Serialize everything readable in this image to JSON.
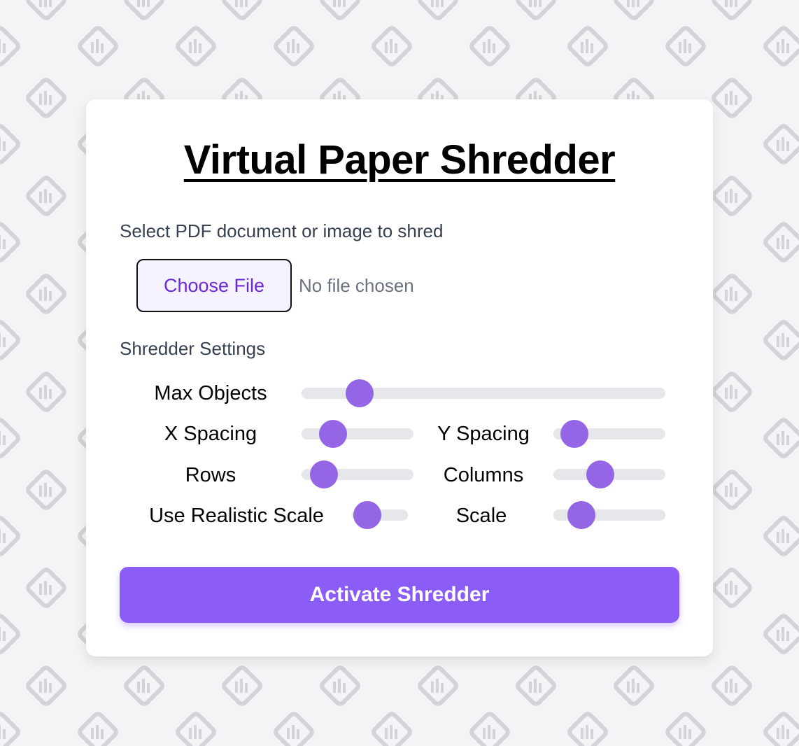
{
  "page": {
    "title": "Virtual Paper Shredder",
    "file_prompt": "Select PDF document or image to shred",
    "choose_file_label": "Choose File",
    "no_file_text": "No file chosen",
    "settings_heading": "Shredder Settings",
    "activate_label": "Activate Shredder",
    "background_icon": "shredder-icon"
  },
  "sliders": {
    "max_objects": {
      "label": "Max Objects",
      "value_fraction": 0.16
    },
    "x_spacing": {
      "label": "X Spacing",
      "value_fraction": 0.28
    },
    "y_spacing": {
      "label": "Y Spacing",
      "value_fraction": 0.19
    },
    "rows": {
      "label": "Rows",
      "value_fraction": 0.2
    },
    "columns": {
      "label": "Columns",
      "value_fraction": 0.42
    },
    "use_realistic_scale": {
      "label": "Use Realistic Scale",
      "value_fraction": 0.28
    },
    "scale": {
      "label": "Scale",
      "value_fraction": 0.25
    }
  },
  "colors": {
    "accent": "#8b5cf6",
    "slider_thumb": "#9466e6",
    "track": "#e5e7eb",
    "choose_file_text": "#6d28d9",
    "background": "#f3f4f6"
  }
}
